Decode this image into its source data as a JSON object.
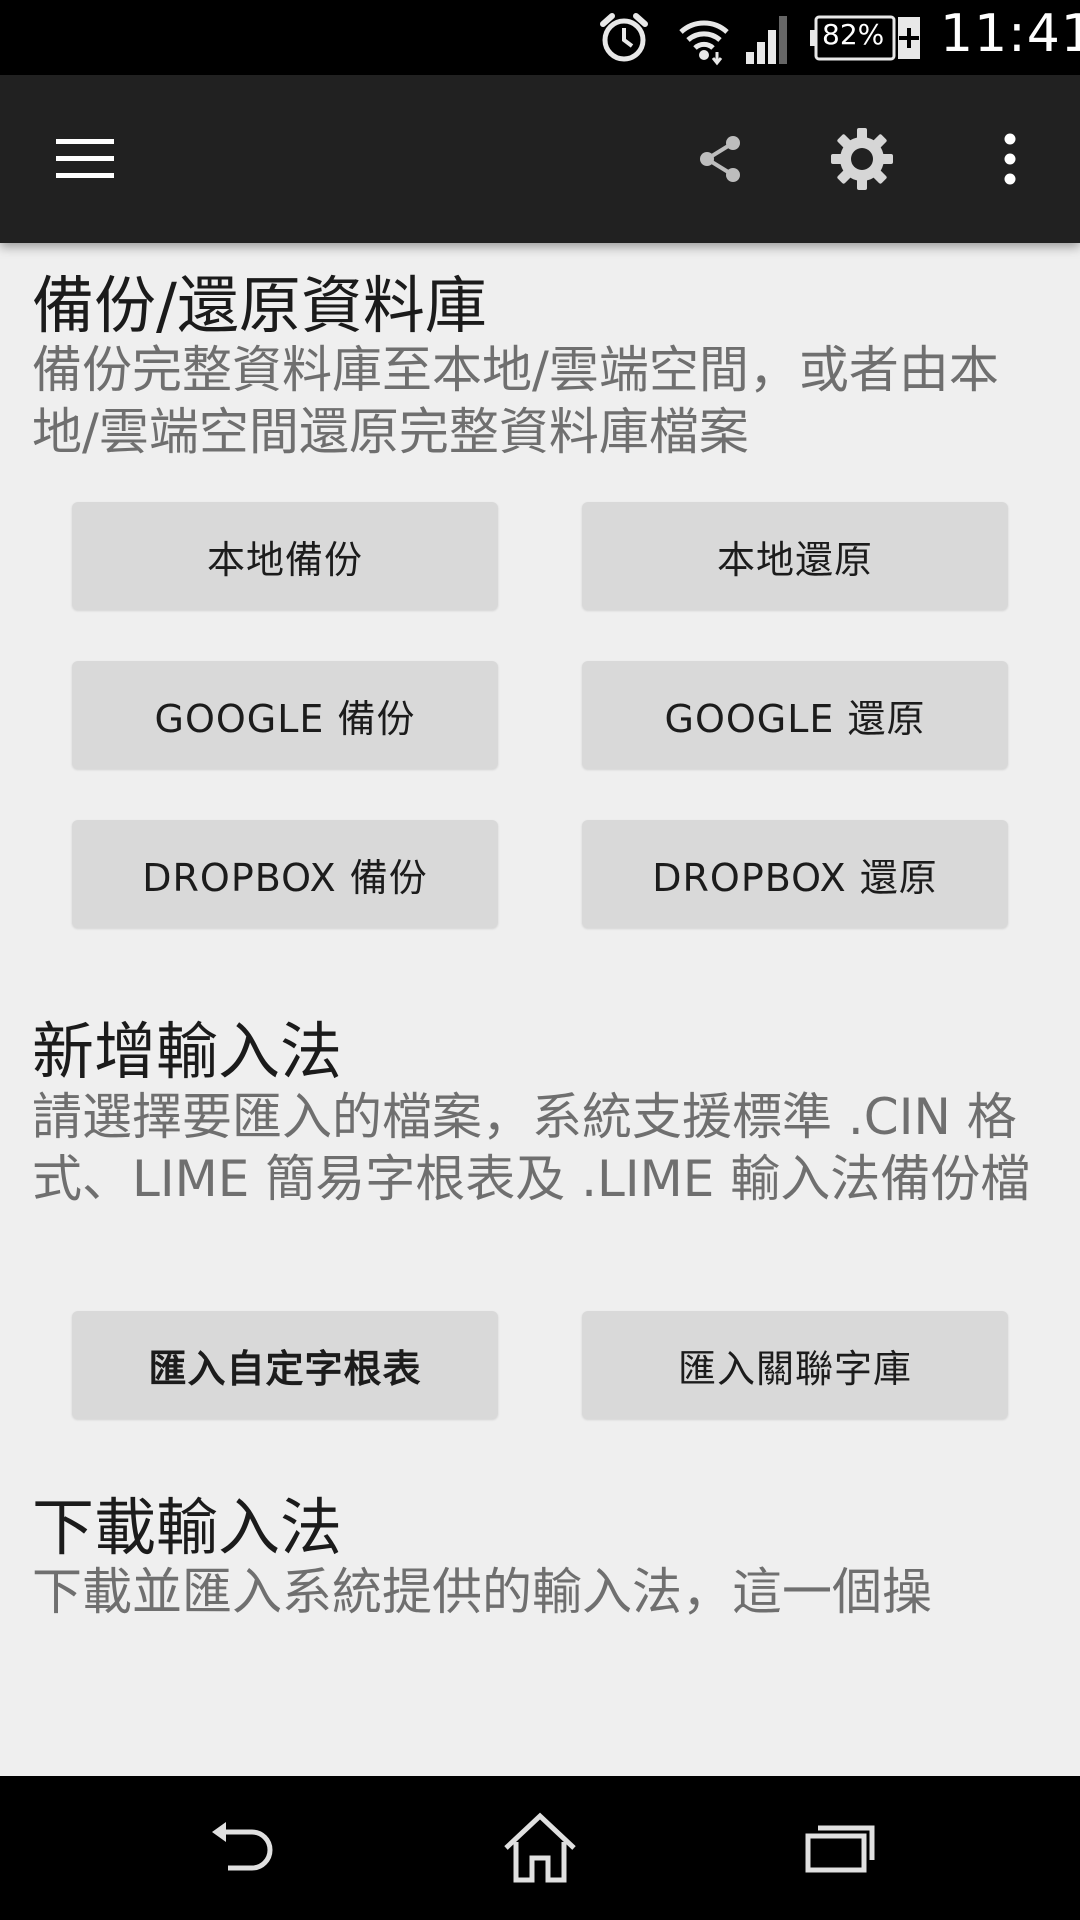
{
  "status_bar": {
    "battery": "82%",
    "time": "11:41"
  },
  "app_bar": {
    "icons": [
      "menu-icon",
      "share-icon",
      "settings-icon",
      "overflow-icon"
    ]
  },
  "sections": {
    "backup": {
      "title": "備份/還原資料庫",
      "description": "備份完整資料庫至本地/雲端空間，或者由本地/雲端空間還原完整資料庫檔案",
      "buttons": {
        "local_backup": "本地備份",
        "local_restore": "本地還原",
        "google_backup": "GOOGLE 備份",
        "google_restore": "GOOGLE 還原",
        "dropbox_backup": "DROPBOX 備份",
        "dropbox_restore": "DROPBOX 還原"
      }
    },
    "add_ime": {
      "title": "新增輸入法",
      "description": "請選擇要匯入的檔案，系統支援標準 .CIN 格式、LIME 簡易字根表及 .LIME 輸入法備份檔",
      "buttons": {
        "import_custom": "匯入自定字根表",
        "import_related": "匯入關聯字庫"
      }
    },
    "download_ime": {
      "title": "下載輸入法",
      "description": "下載並匯入系統提供的輸入法，這一個操"
    }
  },
  "nav_bar": {
    "icons": [
      "back-icon",
      "home-icon",
      "recent-apps-icon"
    ]
  },
  "colors": {
    "status_bar": "#000000",
    "app_bar": "#212121",
    "background": "#efefef",
    "button": "#d9d9d9",
    "title_text": "#1b1b1b",
    "description_text": "#6f6f6f"
  }
}
